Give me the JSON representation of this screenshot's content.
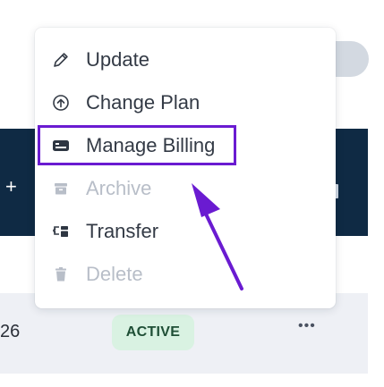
{
  "menu": {
    "items": [
      {
        "label": "Update",
        "icon": "pencil-icon",
        "disabled": false
      },
      {
        "label": "Change Plan",
        "icon": "arrow-up-circle-icon",
        "disabled": false
      },
      {
        "label": "Manage Billing",
        "icon": "billing-card-icon",
        "disabled": false,
        "highlighted": true
      },
      {
        "label": "Archive",
        "icon": "archive-icon",
        "disabled": true
      },
      {
        "label": "Transfer",
        "icon": "transfer-icon",
        "disabled": false
      },
      {
        "label": "Delete",
        "icon": "trash-icon",
        "disabled": true
      }
    ]
  },
  "background": {
    "row_number": "26",
    "status_badge": "ACTIVE",
    "more_label": "•••",
    "plus_label": "+"
  },
  "annotation": {
    "color": "#6a1bd1"
  },
  "colors": {
    "dark_panel": "#0f2a44",
    "badge_bg": "#d9f2e2",
    "badge_text": "#1f4f36",
    "disabled_text": "#b8bec8"
  }
}
